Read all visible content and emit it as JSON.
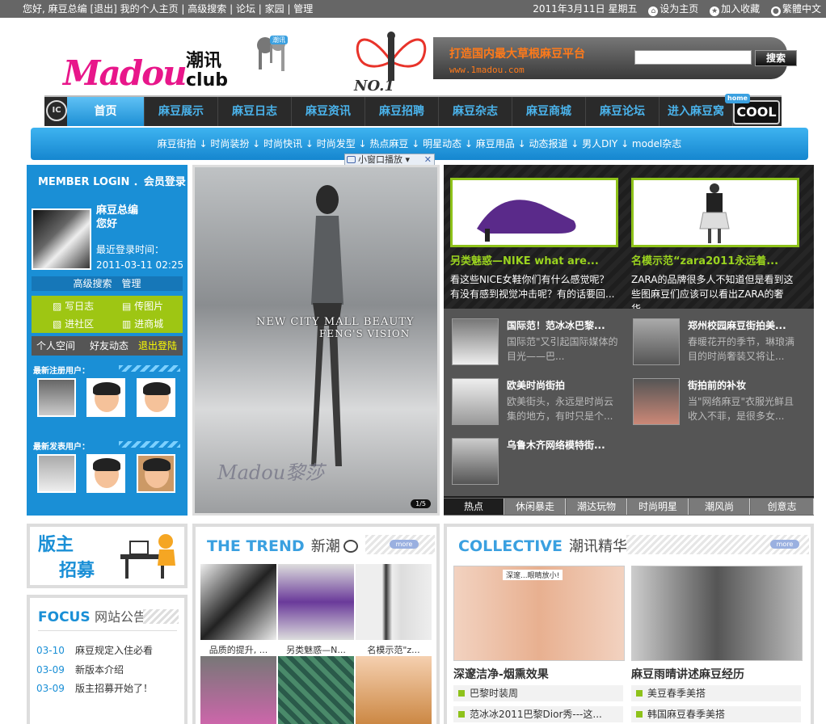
{
  "topbar": {
    "left": "您好, 麻豆总编 [退出] 我的个人主页 | 高级搜索 | 论坛 | 家园 | 管理",
    "date": "2011年3月11日 星期五",
    "set_home": "设为主页",
    "add_fav": "加入收藏",
    "lang": "繁體中文"
  },
  "logo": {
    "main": "Madou",
    "cn": "潮讯",
    "club": "club",
    "tag": "潮讯"
  },
  "banner": {
    "no1": "NO.1",
    "slogan": "打造国内最大草根麻豆平台",
    "url": "www.1madou.com"
  },
  "search": {
    "button": "搜索",
    "placeholder": ""
  },
  "nav": {
    "emblem": "IC",
    "items": [
      "首页",
      "麻豆展示",
      "麻豆日志",
      "麻豆资讯",
      "麻豆招聘",
      "麻豆杂志",
      "麻豆商城",
      "麻豆论坛",
      "进入麻豆窝"
    ],
    "cool": "COOL",
    "home_tag": "home"
  },
  "subnav": "麻豆街拍 ↓ 时尚装扮 ↓ 时尚快讯 ↓ 时尚发型 ↓ 热点麻豆 ↓ 明星动态 ↓ 麻豆用品 ↓ 动态报道 ↓ 男人DIY ↓ model杂志",
  "mini_window": "小窗口播放",
  "login": {
    "title": "MEMBER LOGIN ．会员登录",
    "name": "麻豆总编",
    "greet": "您好",
    "last_label": "最近登录时间：",
    "last_time": "2011-03-11 02:25",
    "links": "高级搜索　管理",
    "grid": [
      "写日志",
      "传图片",
      "进社区",
      "进商城"
    ],
    "bar": [
      "个人空间",
      "好友动态",
      "退出登陆"
    ],
    "new_users": "最新注册用户：",
    "new_posters": "最新发表用户："
  },
  "hero": {
    "line1": "NEW CITY MALL BEAUTY",
    "line2": "FENG'S VISION",
    "watermark": "Madou黎莎",
    "pager": "1/5"
  },
  "hot": {
    "features": [
      {
        "title": "另类魅惑—NIKE what are...",
        "desc": "看这些NICE女鞋你们有什么感觉呢？有没有感到视觉冲击呢？有的话要回..."
      },
      {
        "title": "名模示范“zara2011永远着...",
        "desc": "ZARA的品牌很多人不知道但是看到这些图麻豆们应该可以看出ZARA的奢华..."
      }
    ],
    "items": [
      {
        "title": "国际范！范冰冰巴黎...",
        "desc": "国际范\"又引起国际媒体的目光——巴..."
      },
      {
        "title": "郑州校园麻豆街拍美...",
        "desc": "春暖花开的季节，琳琅满目的时尚奢装又将让..."
      },
      {
        "title": "欧美时尚街拍",
        "desc": "欧美街头，永远是时尚云集的地方，有时只是个..."
      },
      {
        "title": "街拍前的补妆",
        "desc": "当\"网络麻豆\"衣服光鲜且收入不菲，是很多女..."
      },
      {
        "title": "乌鲁木齐网络模特街...",
        "desc": ""
      }
    ],
    "tabs": [
      "热点",
      "休闲暴走",
      "潮达玩物",
      "时尚明星",
      "潮风尚",
      "创意志"
    ]
  },
  "recruit": {
    "a": "版主",
    "b": "招募"
  },
  "notice": {
    "focus": "FOCUS",
    "title": "网站公告",
    "rows": [
      {
        "date": "03-10",
        "text": "麻豆规定入住必看"
      },
      {
        "date": "03-09",
        "text": "新版本介绍"
      },
      {
        "date": "03-09",
        "text": "版主招募开始了！"
      }
    ]
  },
  "trend": {
    "en": "THE TREND",
    "zh": "新潮",
    "more": "more",
    "captions": [
      "品质的提升, ...",
      "另类魅惑—N...",
      "名模示范\"z..."
    ]
  },
  "collective": {
    "en": "COLLECTIVE",
    "zh": "潮讯精华",
    "more": "more",
    "img_text": "深邃...眼睛放小!",
    "captions": [
      "深邃洁净-烟熏效果",
      "麻豆雨晴讲述麻豆经历"
    ],
    "subs": [
      "巴黎时装周",
      "美豆春季美搭",
      "范冰冰2011巴黎Dior秀---这...",
      "韩国麻豆春季美搭"
    ]
  }
}
